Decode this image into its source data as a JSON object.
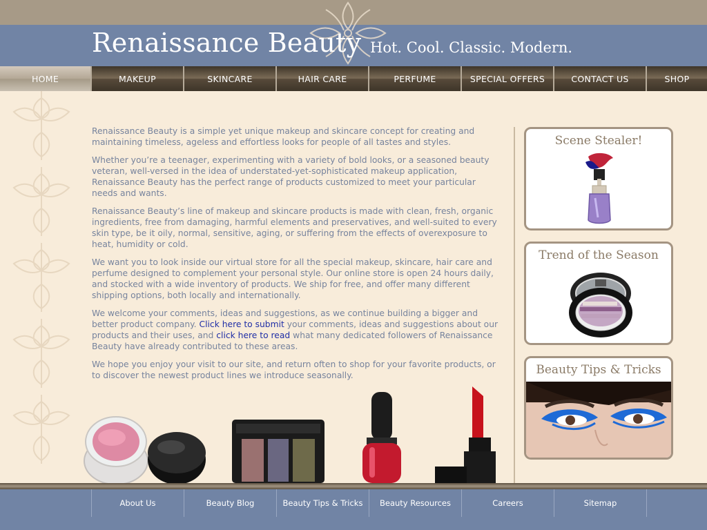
{
  "header": {
    "brand": "Renaissance Beauty",
    "tagline": "Hot. Cool. Classic. Modern."
  },
  "nav": {
    "items": [
      {
        "label": "HOME",
        "active": true
      },
      {
        "label": "MAKEUP"
      },
      {
        "label": "SKINCARE"
      },
      {
        "label": "HAIR CARE"
      },
      {
        "label": "PERFUME"
      },
      {
        "label": "SPECIAL OFFERS"
      },
      {
        "label": "CONTACT US"
      },
      {
        "label": "SHOP"
      }
    ]
  },
  "main": {
    "p1": "Renaissance Beauty is a simple yet unique makeup and skincare concept for creating and maintaining timeless, ageless and effortless looks for people of all tastes and styles.",
    "p2": "Whether you’re a teenager, experimenting with a variety of bold looks, or a seasoned beauty veteran, well-versed in the idea of understated-yet-sophisticated makeup application, Renaissance Beauty has the perfect range of products customized to meet your particular needs and wants.",
    "p3": "Renaissance Beauty’s line of makeup and skincare products is made with clean, fresh, organic ingredients, free from damaging, harmful elements and preservatives, and well-suited to every skin type, be it oily, normal, sensitive, aging, or suffering from the effects of overexposure to heat, humidity or cold.",
    "p4": "We want you to look inside our virtual store for all the special makeup, skincare, hair care and perfume designed to complement your personal style. Our online store is open 24 hours daily, and stocked with a wide inventory of products. We ship for free, and offer many different shipping options, both locally and internationally.",
    "p5_a": "We welcome your comments, ideas and suggestions, as we continue building a bigger and better product company.",
    "p5_link1": "Click here to submit",
    "p5_b": "your comments, ideas and suggestions about our products and their uses, and",
    "p5_link2": "click here to read",
    "p5_c": "what many dedicated followers of Renaissance Beauty have already contributed to these areas.",
    "p6": "We hope you enjoy your visit to our site, and return often to shop for your favorite products, or to discover the newest product lines we introduce seasonally."
  },
  "sidebar": {
    "scene_stealer": "Scene Stealer!",
    "trend": "Trend of the Season",
    "tips": "Beauty Tips & Tricks"
  },
  "footer": {
    "links": [
      "About Us",
      "Beauty Blog",
      "Beauty Tips & Tricks",
      "Beauty Resources",
      "Careers",
      "Sitemap"
    ]
  },
  "colors": {
    "brand_blue": "#7184a5",
    "taupe": "#a79a87",
    "cream": "#f8ecda",
    "link": "#1f2ea6"
  }
}
